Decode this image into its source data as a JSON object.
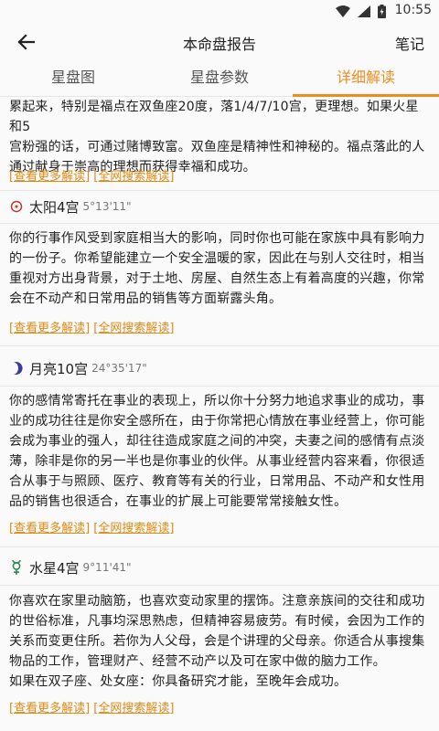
{
  "status": {
    "time": "10:55"
  },
  "header": {
    "title": "本命盘报告",
    "notes_label": "笔记"
  },
  "tabs": [
    {
      "label": "星盘图"
    },
    {
      "label": "星盘参数"
    },
    {
      "label": "详细解读"
    }
  ],
  "link_more": "[查看更多解读]",
  "link_search": "[全网搜索解读]",
  "intro": {
    "lines": [
      "累起来，特别是福点在双鱼座20度，落1/4/7/10宫，更理想。如果火星和5",
      "宫粉强的话，可通过赌博致富。双鱼座是精神性和神秘的。福点落此的人",
      "通过献身于崇高的理想而获得幸福和成功。"
    ]
  },
  "sections": [
    {
      "title": "太阳4宫",
      "degree": "5°13'11\"",
      "icon": "sun-symbol",
      "lines": [
        "你的行事作风受到家庭相当大的影响，同时你也可能在家族中具有影响力",
        "的一份子。你希望能建立一个安全温暖的家，因此在与别人交往时，相当",
        "重视对方出身背景，对于土地、房屋、自然生态上有着高度的兴趣，你常",
        "会在不动产和日常用品的销售等方面崭露头角。"
      ]
    },
    {
      "title": "月亮10宫",
      "degree": "24°35'17\"",
      "icon": "moon-symbol",
      "lines": [
        "你的感情常寄托在事业的表现上，所以你十分努力地追求事业的成功，事",
        "业的成功往往是你安全感所在，由于你常把心情放在事业经营上，你可能",
        "会成为事业的强人，却往往造成家庭之间的冲突，夫妻之间的感情有点淡",
        "薄，除非是你的另一半也是你事业的伙伴。从事业经营内容来看，你很适",
        "合从事于与照顾、医疗、教育等有关的行业，日常用品、不动产和女性用",
        "品的销售也很适合，在事业的扩展上可能要常常接触女性。"
      ]
    },
    {
      "title": "水星4宫",
      "degree": "9°11'41\"",
      "icon": "mercury-symbol",
      "lines": [
        "你喜欢在家里动脑筋，也喜欢变动家里的摆饰。注意亲族间的交往和成功",
        "的世俗标准，凡事均深思熟虑，但精神容易疲劳。有时候，会因为工作的",
        "关系而变更住所。若你为人父母，会是个讲理的父母亲。你适合从事搜集",
        "物品的工作，管理财产、经营不动产以及可在家中做的脑力工作。",
        "如果在双子座、处女座：你具备研究才能，至晚年会成功。"
      ]
    }
  ]
}
